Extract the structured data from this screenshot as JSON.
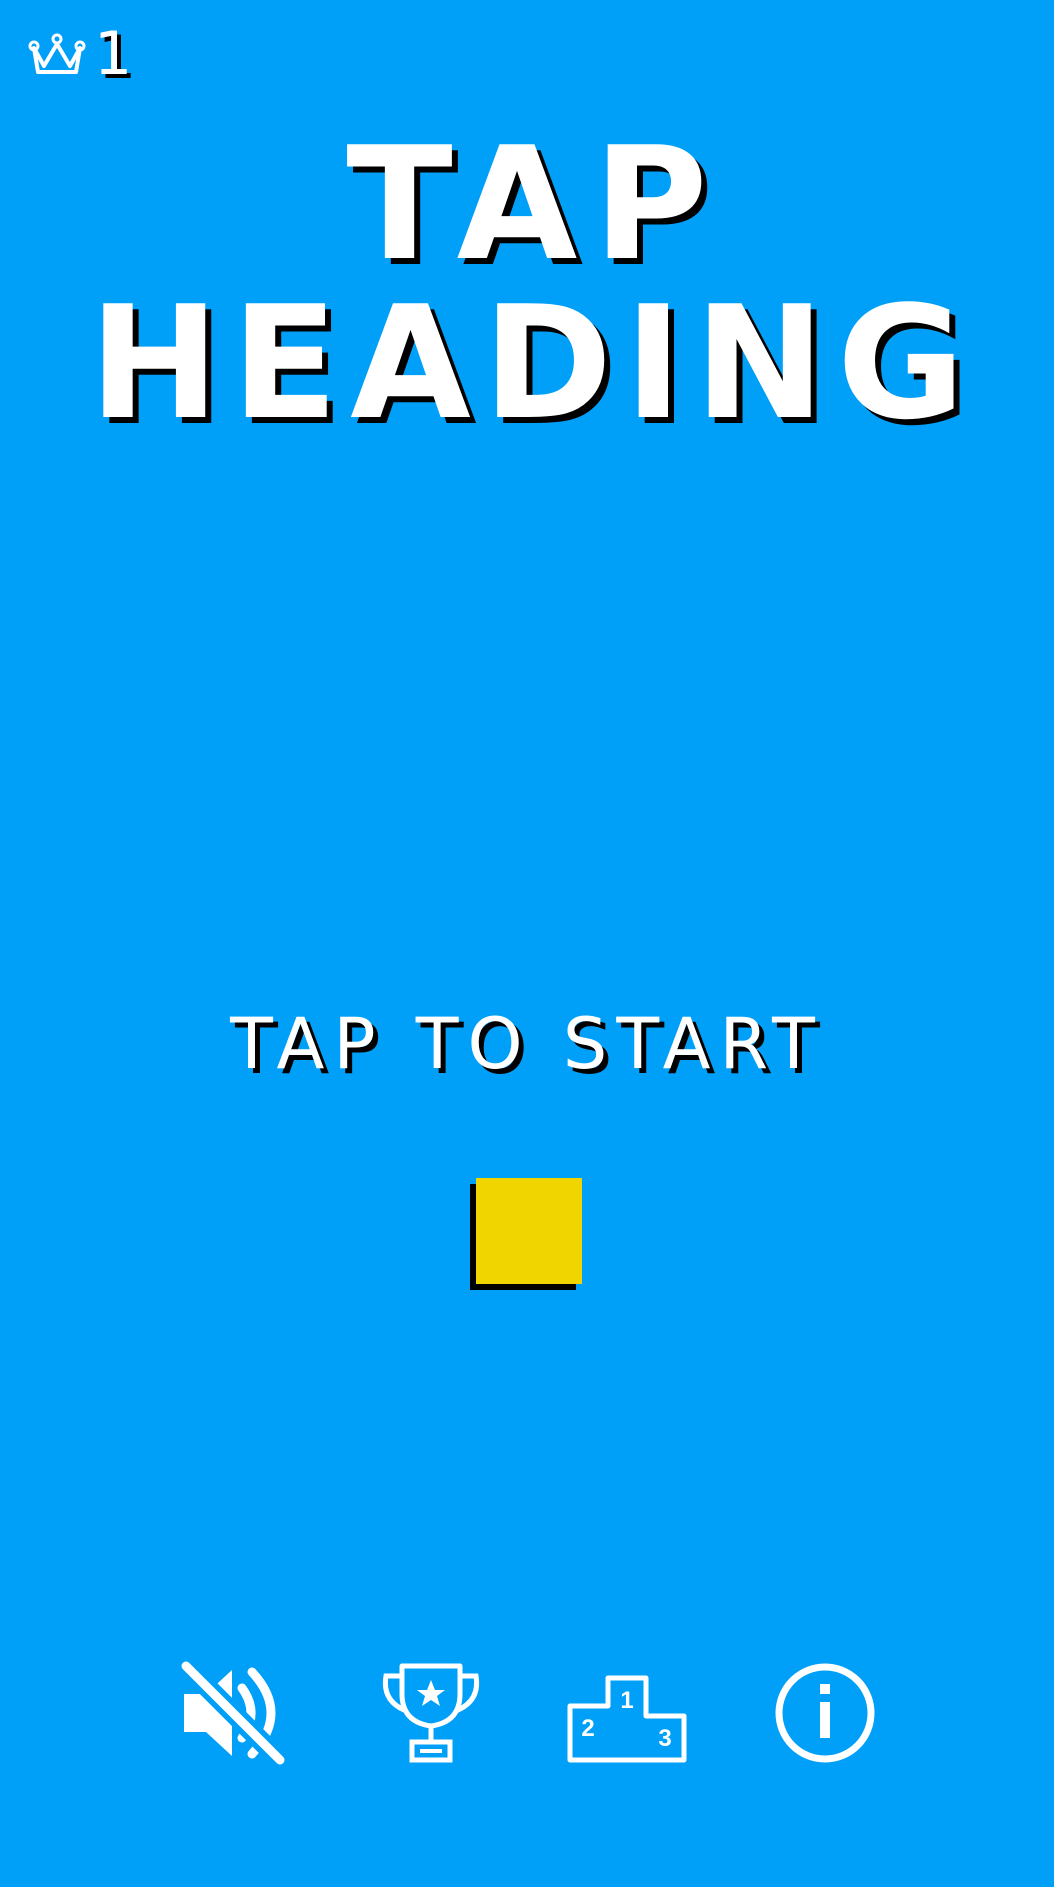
{
  "hud": {
    "best_score": "1",
    "crown_icon": "crown-icon"
  },
  "title": {
    "line1": "TAP",
    "line2": "HEADING"
  },
  "prompt": "TAP TO START",
  "player": {
    "color": "#F0D500"
  },
  "toolbar": {
    "buttons": [
      {
        "icon": "sound-muted-icon"
      },
      {
        "icon": "trophy-icon"
      },
      {
        "icon": "leaderboard-podium-icon"
      },
      {
        "icon": "info-icon"
      }
    ],
    "podium_labels": [
      "1",
      "2",
      "3"
    ]
  },
  "colors": {
    "background": "#00A0F9",
    "text": "#FFFFFF",
    "shadow": "#000000",
    "player": "#F0D500"
  }
}
